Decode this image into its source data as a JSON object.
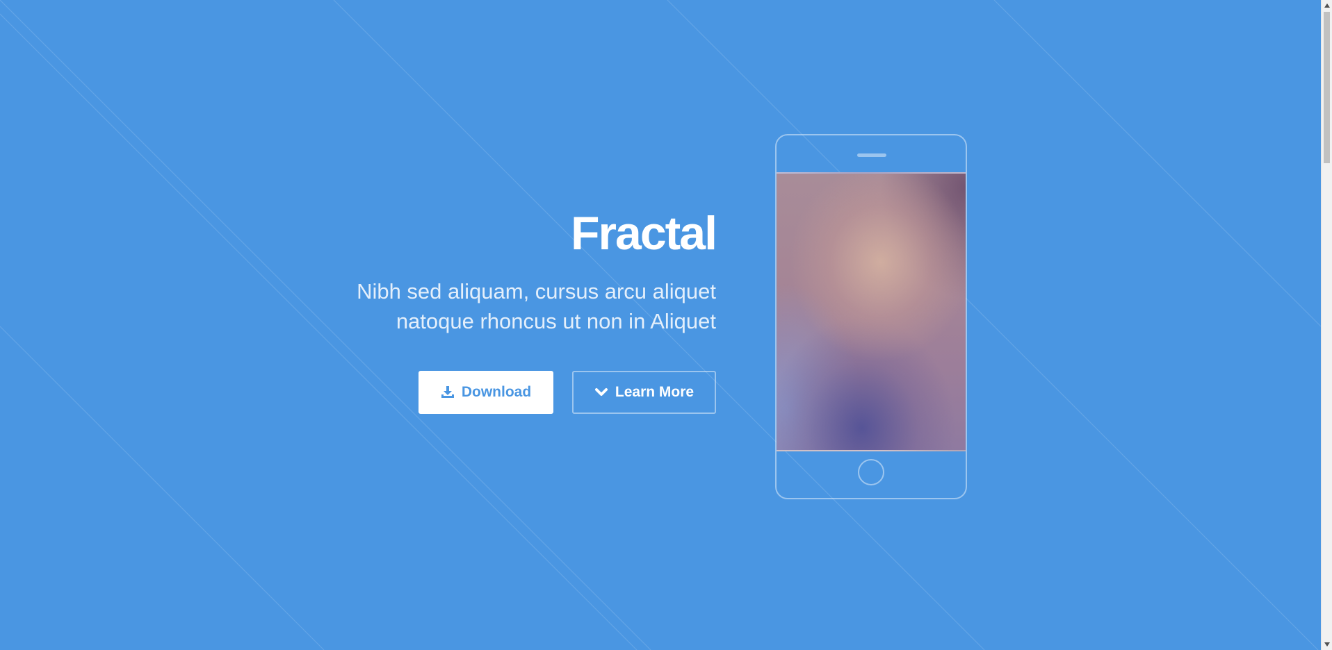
{
  "colors": {
    "background": "#4a96e2",
    "accent": "#ffffff",
    "button_text": "#4a96e2"
  },
  "hero": {
    "title": "Fractal",
    "subtitle_line1": "Nibh sed aliquam, cursus arcu aliquet",
    "subtitle_line2": "natoque rhoncus ut non in Aliquet"
  },
  "buttons": {
    "download_label": "Download",
    "download_icon": "download-icon",
    "learn_more_label": "Learn More",
    "learn_more_icon": "chevron-down-icon"
  },
  "phone": {
    "screen_image": "blurred-gradient-wallpaper"
  }
}
